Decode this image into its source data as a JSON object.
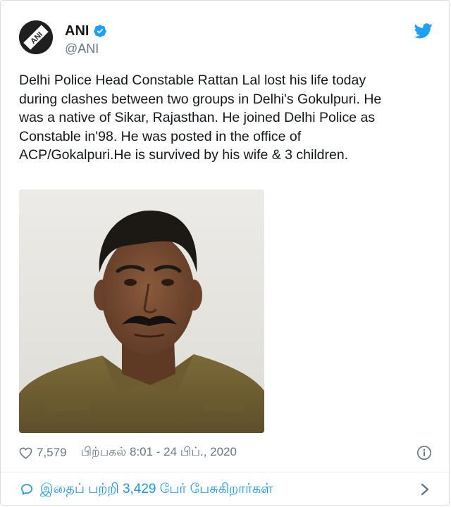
{
  "author": {
    "name": "ANI",
    "handle": "@ANI",
    "avatar_logo_text": "ANI",
    "verified_icon": "verified-badge-icon"
  },
  "tweet": {
    "text": "Delhi Police Head Constable Rattan Lal lost his life today\nduring clashes between two groups in Delhi's Gokulpuri. He\nwas a native of Sikar, Rajasthan. He joined Delhi Police as\nConstable in'98. He was posted in the office of\nACP/Gokalpuri.He is survived by his wife & 3 children.",
    "photo_alt": "Portrait photo of Head Constable Rattan Lal in uniform"
  },
  "meta": {
    "like_icon": "heart-icon",
    "likes": "7,579",
    "timestamp": "பிற்பகல் 8:01 - 24 பிப்., 2020",
    "info_icon": "info-icon"
  },
  "footer": {
    "comment_icon": "comment-icon",
    "text": "இதைப் பற்றி 3,429 பேர் பேசுகிறார்கள்",
    "chevron_icon": "chevron-right-icon"
  },
  "colors": {
    "twitter_blue": "#1da1f2",
    "link_blue": "#1b95e0",
    "secondary_text": "#657786",
    "primary_text": "#14171a"
  }
}
